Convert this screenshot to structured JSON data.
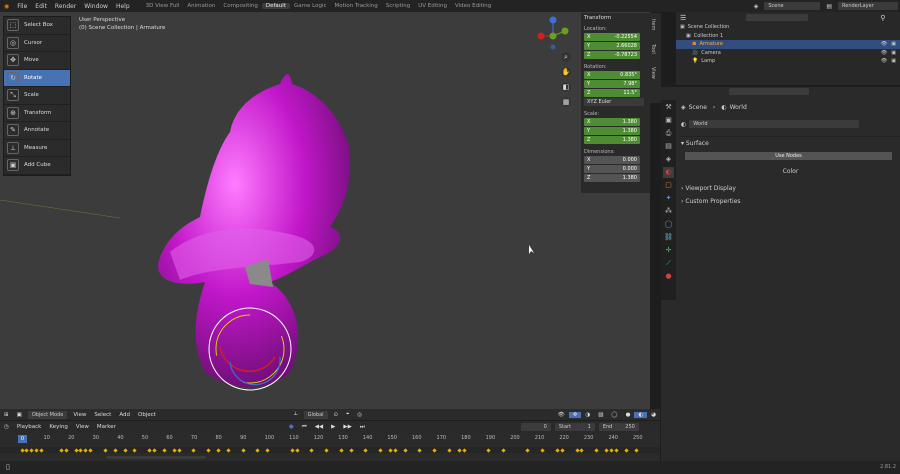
{
  "menu": [
    "File",
    "Edit",
    "Render",
    "Window",
    "Help"
  ],
  "workspaces": [
    "3D View Full",
    "Animation",
    "Compositing",
    "Default",
    "Game Logic",
    "Motion Tracking",
    "Scripting",
    "UV Editing",
    "Video Editing"
  ],
  "active_workspace": "Default",
  "scene": {
    "label": "Scene",
    "render_layer": "RenderLayer"
  },
  "viewport": {
    "title": "User Perspective",
    "subtitle": "(0) Scene Collection | Armature"
  },
  "tools": [
    {
      "label": "Select Box",
      "icon": "select-box-icon",
      "glyph": "⬚",
      "active": false
    },
    {
      "label": "Cursor",
      "icon": "cursor-icon",
      "glyph": "◎",
      "active": false
    },
    {
      "label": "Move",
      "icon": "move-icon",
      "glyph": "✥",
      "active": false
    },
    {
      "label": "Rotate",
      "icon": "rotate-icon",
      "glyph": "↻",
      "active": true
    },
    {
      "label": "Scale",
      "icon": "scale-icon",
      "glyph": "⤡",
      "active": false
    },
    {
      "label": "Transform",
      "icon": "transform-icon",
      "glyph": "⊕",
      "active": false
    },
    {
      "label": "Annotate",
      "icon": "annotate-icon",
      "glyph": "✎",
      "active": false
    },
    {
      "label": "Measure",
      "icon": "measure-icon",
      "glyph": "⟂",
      "active": false
    },
    {
      "label": "Add Cube",
      "icon": "add-cube-icon",
      "glyph": "▣",
      "active": false
    }
  ],
  "npanel": {
    "header": "Transform",
    "location_label": "Location:",
    "location": [
      {
        "axis": "X",
        "value": "-0.22554"
      },
      {
        "axis": "Y",
        "value": "2.66028"
      },
      {
        "axis": "Z",
        "value": "-0.78723"
      }
    ],
    "rotation_label": "Rotation:",
    "rotation": [
      {
        "axis": "X",
        "value": "0.835°"
      },
      {
        "axis": "Y",
        "value": "7.98°"
      },
      {
        "axis": "Z",
        "value": "11.5°"
      }
    ],
    "rotation_mode": "XYZ Euler",
    "scale_label": "Scale:",
    "scale": [
      {
        "axis": "X",
        "value": "1.380"
      },
      {
        "axis": "Y",
        "value": "1.380"
      },
      {
        "axis": "Z",
        "value": "1.380"
      }
    ],
    "dimensions_label": "Dimensions:",
    "dimensions": [
      {
        "axis": "X",
        "value": "0.000"
      },
      {
        "axis": "Y",
        "value": "0.000"
      },
      {
        "axis": "Z",
        "value": "1.380"
      }
    ],
    "tabs": [
      "Item",
      "Tool",
      "View"
    ]
  },
  "outliner": {
    "items": [
      {
        "label": "Scene Collection",
        "indent": 0,
        "selected": false
      },
      {
        "label": "Collection 1",
        "indent": 1,
        "selected": false
      },
      {
        "label": "Armature",
        "indent": 2,
        "selected": true
      },
      {
        "label": "Camera",
        "indent": 2,
        "selected": false
      },
      {
        "label": "Lamp",
        "indent": 2,
        "selected": false
      }
    ]
  },
  "properties": {
    "breadcrumb_scene": "Scene",
    "breadcrumb_world": "World",
    "world_name": "World",
    "surface_label": "Surface",
    "use_nodes_label": "Use Nodes",
    "color_label": "Color",
    "viewport_display_label": "Viewport Display",
    "custom_properties_label": "Custom Properties"
  },
  "header3d": {
    "mode": "Object Mode",
    "view": "View",
    "select": "Select",
    "add": "Add",
    "object": "Object",
    "orientation": "Global"
  },
  "timeline": {
    "playback": "Playback",
    "keying": "Keying",
    "view": "View",
    "marker": "Marker",
    "current_frame": "0",
    "start_label": "Start",
    "start": "1",
    "end_label": "End",
    "end": "250",
    "ticks": [
      0,
      10,
      20,
      30,
      40,
      50,
      60,
      70,
      80,
      90,
      100,
      110,
      120,
      130,
      140,
      150,
      160,
      170,
      180,
      190,
      200,
      210,
      220,
      230,
      240,
      250
    ],
    "keyframes": [
      0,
      2,
      4,
      6,
      8,
      16,
      18,
      22,
      24,
      26,
      28,
      34,
      38,
      42,
      46,
      52,
      54,
      58,
      62,
      64,
      70,
      76,
      80,
      84,
      90,
      96,
      100,
      110,
      112,
      118,
      124,
      130,
      134,
      140,
      146,
      150,
      152,
      156,
      162,
      168,
      174,
      178,
      180,
      190,
      196,
      206,
      212,
      218,
      220,
      226,
      228,
      234,
      238,
      240,
      242,
      246,
      250
    ]
  },
  "status": {
    "version": "2.81.2"
  },
  "colors": {
    "accent": "#4772b3",
    "field_green": "#4e8d33",
    "mesh": "#c117c9",
    "keyframe": "#e6b000",
    "selected_row": "#334d80"
  }
}
